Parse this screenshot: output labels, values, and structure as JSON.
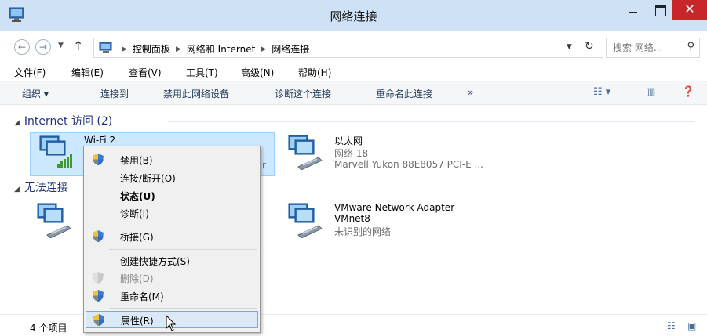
{
  "window": {
    "title": "网络连接",
    "close_glyph": "✕"
  },
  "address": {
    "breadcrumbs": [
      "控制面板",
      "网络和 Internet",
      "网络连接"
    ],
    "search_placeholder": "搜索 网络..."
  },
  "menubar": [
    "文件(F)",
    "编辑(E)",
    "查看(V)",
    "工具(T)",
    "高级(N)",
    "帮助(H)"
  ],
  "commandbar": {
    "organize": "组织 ▾",
    "items": [
      "连接到",
      "禁用此网络设备",
      "诊断这个连接",
      "重命名此连接"
    ],
    "more": "»"
  },
  "groups": {
    "internet": {
      "label": "Internet 访问 (2)"
    },
    "unidentified": {
      "label": "无法连接"
    }
  },
  "connections": {
    "wifi2": {
      "name": "Wi-Fi 2",
      "detail_fragment": "r"
    },
    "ethernet": {
      "name": "以太网",
      "network": "网络 18",
      "device": "Marvell Yukon 88E8057 PCI-E ..."
    },
    "vmnet8": {
      "name": "VMware Network Adapter",
      "name2": "VMnet8",
      "status": "未识别的网络"
    }
  },
  "context_menu": {
    "disable": "禁用(B)",
    "connect": "连接/断开(O)",
    "status": "状态(U)",
    "diagnose": "诊断(I)",
    "bridge": "桥接(G)",
    "shortcut": "创建快捷方式(S)",
    "delete": "删除(D)",
    "rename": "重命名(M)",
    "properties": "属性(R)"
  },
  "statusbar": {
    "count": "4 个项目"
  },
  "colors": {
    "titlebar": "#cfe2f5",
    "close": "#c7262b",
    "selection": "#cce8ff",
    "menu_highlight": "#dbe9f7",
    "group_header": "#1e3287"
  },
  "icons": {
    "wifi": "monitors-with-signal-bars-icon",
    "ethernet": "monitors-with-cable-icon",
    "uac": "uac-shield-icon"
  }
}
